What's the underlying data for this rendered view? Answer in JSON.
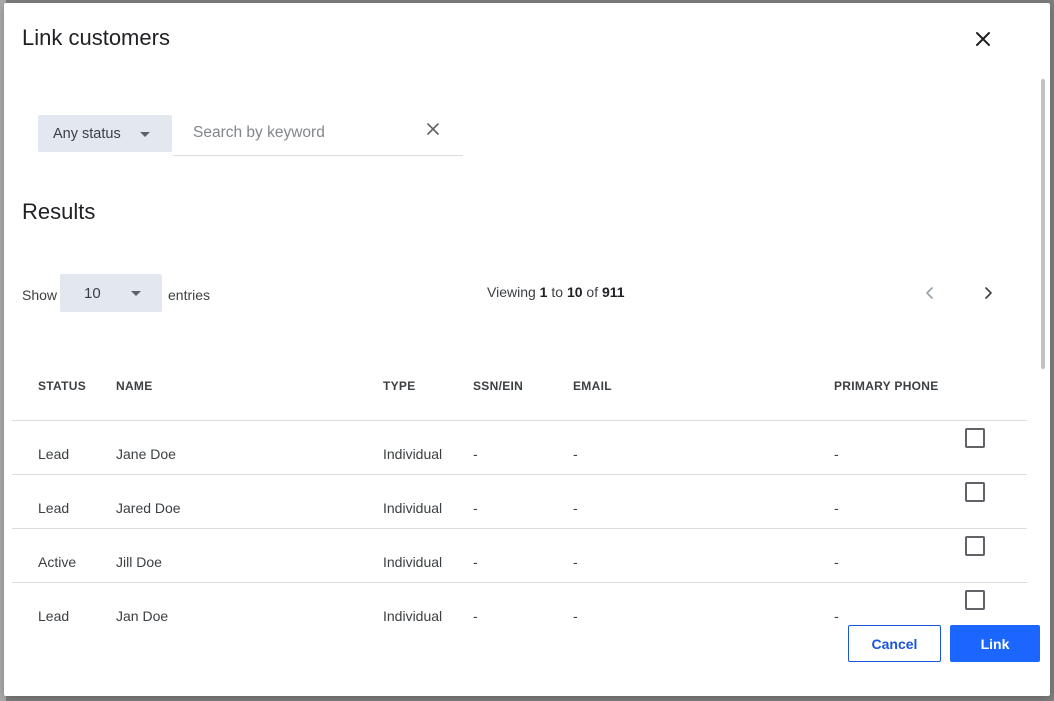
{
  "dialog": {
    "title": "Link customers",
    "close_icon": "close-icon"
  },
  "filters": {
    "status_value": "Any status",
    "search_placeholder": "Search by keyword",
    "search_value": ""
  },
  "results": {
    "heading": "Results",
    "show_label": "Show",
    "entries_value": "10",
    "entries_label": "entries",
    "viewing_prefix": "Viewing",
    "viewing_from": "1",
    "viewing_to_word": "to",
    "viewing_to": "10",
    "viewing_of_word": "of",
    "viewing_total": "911"
  },
  "table": {
    "columns": [
      "STATUS",
      "NAME",
      "TYPE",
      "SSN/EIN",
      "EMAIL",
      "PRIMARY PHONE"
    ],
    "rows": [
      {
        "status": "Lead",
        "name": "Jane Doe",
        "type": "Individual",
        "ssn": "-",
        "email": "-",
        "phone": "-"
      },
      {
        "status": "Lead",
        "name": "Jared Doe",
        "type": "Individual",
        "ssn": "-",
        "email": "-",
        "phone": "-"
      },
      {
        "status": "Active",
        "name": "Jill Doe",
        "type": "Individual",
        "ssn": "-",
        "email": "-",
        "phone": "-"
      },
      {
        "status": "Lead",
        "name": "Jan Doe",
        "type": "Individual",
        "ssn": "-",
        "email": "-",
        "phone": "-"
      }
    ]
  },
  "actions": {
    "cancel_label": "Cancel",
    "link_label": "Link"
  },
  "colors": {
    "accent": "#1a66ff",
    "select_bg": "#e2e7f0"
  }
}
